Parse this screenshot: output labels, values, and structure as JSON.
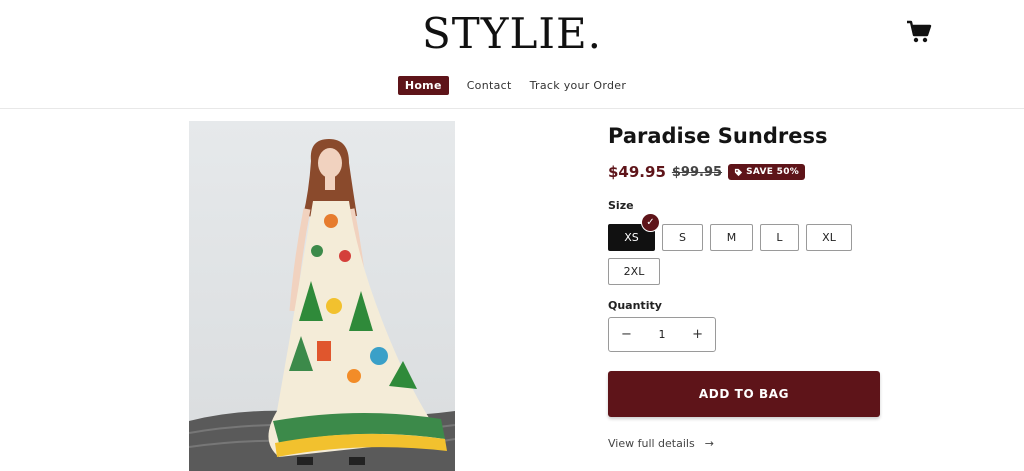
{
  "brand": {
    "logo": "STYLIE."
  },
  "header": {
    "cart_icon": "cart-icon"
  },
  "nav": {
    "items": [
      {
        "label": "Home",
        "active": true
      },
      {
        "label": "Contact",
        "active": false
      },
      {
        "label": "Track your Order",
        "active": false
      }
    ]
  },
  "product": {
    "title": "Paradise Sundress",
    "price": "$49.95",
    "compare_price": "$99.95",
    "badge": "SAVE 50%",
    "size_label": "Size",
    "sizes": [
      "XS",
      "S",
      "M",
      "L",
      "XL",
      "2XL"
    ],
    "selected_size": "XS",
    "quantity_label": "Quantity",
    "quantity": "1",
    "add_to_bag": "ADD TO BAG",
    "details_link": "View full details",
    "image": "product-photo"
  },
  "colors": {
    "accent": "#5e1419"
  }
}
